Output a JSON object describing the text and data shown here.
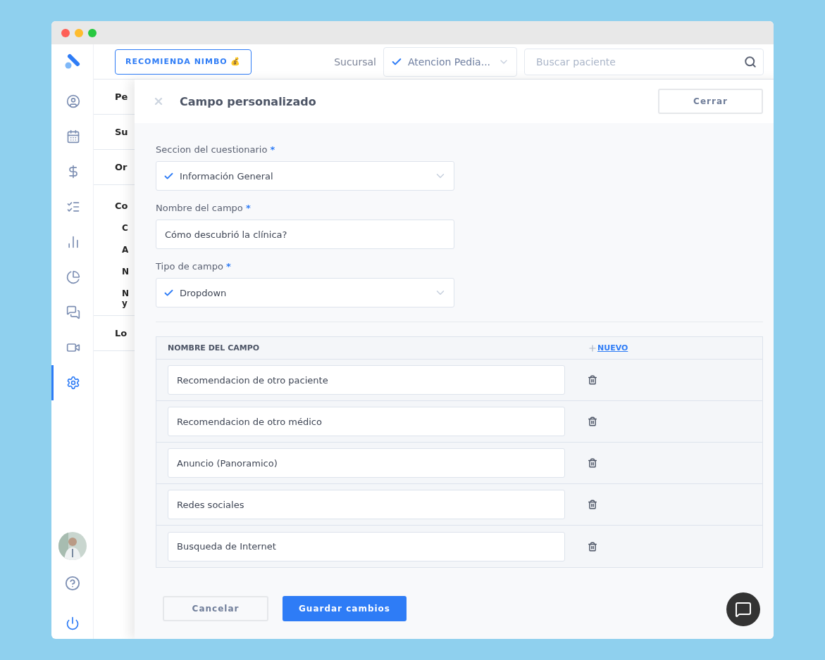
{
  "top_bar": {
    "promo_button": "RECOMIENDA NIMBO 💰",
    "branch_label": "Sucursal",
    "branch_value": "Atencion Pedia...",
    "search": {
      "placeholder": "Buscar paciente"
    }
  },
  "sidebar": {
    "items": [
      {
        "selected": false
      },
      {
        "selected": false
      },
      {
        "selected": false
      },
      {
        "selected": false
      },
      {
        "selected": false
      },
      {
        "selected": false
      },
      {
        "selected": false
      },
      {
        "selected": false
      },
      {
        "selected": true
      }
    ]
  },
  "settings_menu": [
    {
      "kind": "section",
      "label": "Pe"
    },
    {
      "kind": "section",
      "label": "Su"
    },
    {
      "kind": "section",
      "label": "Or"
    },
    {
      "kind": "group",
      "label": "Co",
      "children": [
        {
          "label": "C"
        },
        {
          "label": "A"
        },
        {
          "label": "N"
        },
        {
          "label": "N y"
        }
      ]
    },
    {
      "kind": "section",
      "label": "Lo"
    }
  ],
  "modal": {
    "title": "Campo personalizado",
    "close_button": "Cerrar",
    "fields": [
      {
        "kind": "select",
        "label": "Seccion del cuestionario",
        "required_mark": "*",
        "value": "Información General"
      },
      {
        "kind": "text",
        "label": "Nombre del campo",
        "required_mark": "*",
        "value": "Cómo descubrió la clínica?"
      },
      {
        "kind": "select",
        "label": "Tipo de campo",
        "required_mark": "*",
        "value": "Dropdown"
      }
    ],
    "table": {
      "column_1": "NOMBRE DEL CAMPO",
      "add_link": " NUEVO",
      "rows": [
        "Recomendacion de otro paciente",
        "Recomendacion de otro médico",
        "Anuncio (Panoramico)",
        "Redes sociales",
        "Busqueda de Internet"
      ]
    },
    "cancel_button": "Cancelar",
    "save_button": "Guardar cambios"
  }
}
